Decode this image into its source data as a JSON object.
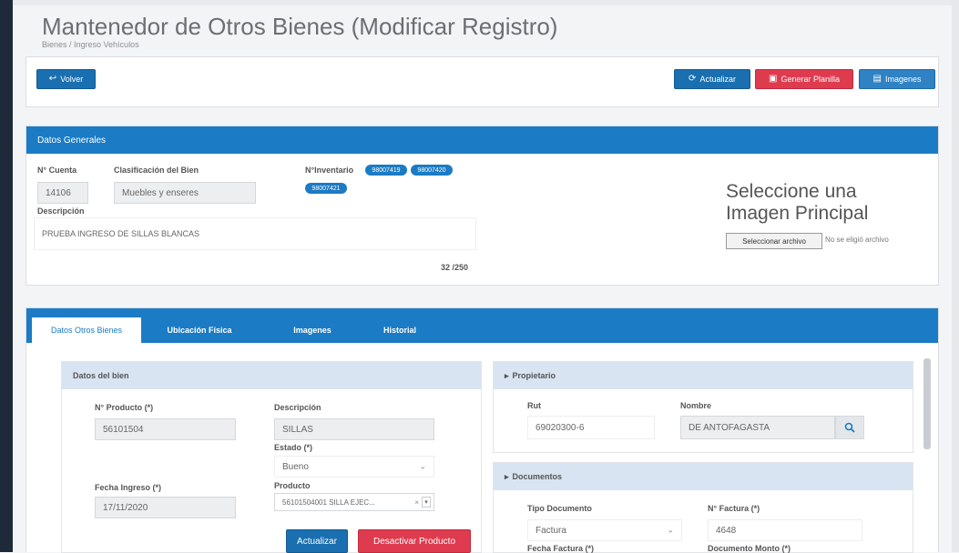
{
  "page": {
    "title": "Mantenedor de Otros Bienes (Modificar Registro)",
    "breadcrumb": "Bienes / Ingreso Vehículos"
  },
  "toolbar": {
    "back_label": "Volver",
    "update_label": "Actualizar",
    "generate_label": "Generar Planilla",
    "images_label": "Imagenes"
  },
  "general": {
    "header": "Datos Generales",
    "account_label": "N° Cuenta",
    "account_value": "14106",
    "classification_label": "Clasificación del Bien",
    "classification_value": "Muebles y enseres",
    "inventory_label": "N°Inventario",
    "inventory_pills": [
      "98007419",
      "98007420",
      "98007421"
    ],
    "description_label": "Descripción",
    "description_value": "PRUEBA INGRESO DE SILLAS BLANCAS",
    "char_count": "32 /250",
    "image_prompt_line1": "Seleccione una",
    "image_prompt_line2": "Imagen Principal",
    "file_button": "Seleccionar archivo",
    "file_status": "No se eligió archivo"
  },
  "tabs": [
    {
      "label": "Datos Otros Bienes"
    },
    {
      "label": "Ubicación Física"
    },
    {
      "label": "Imagenes"
    },
    {
      "label": "Historial"
    }
  ],
  "bien": {
    "header": "Datos del bien",
    "product_no_label": "N° Producto (*)",
    "product_no_value": "56101504",
    "description_label": "Descripción",
    "description_value": "SILLAS",
    "state_label": "Estado (*)",
    "state_value": "Bueno",
    "entry_date_label": "Fecha Ingreso (*)",
    "entry_date_value": "17/11/2020",
    "product_label": "Producto",
    "product_value": "56101504001 SILLA EJEC...",
    "update_button": "Actualizar",
    "deactivate_button": "Desactivar Producto"
  },
  "owner": {
    "header": "Propietario",
    "rut_label": "Rut",
    "rut_value": "69020300-6",
    "name_label": "Nombre",
    "name_value": "DE ANTOFAGASTA"
  },
  "documents": {
    "header": "Documentos",
    "doc_type_label": "Tipo Documento",
    "doc_type_value": "Factura",
    "invoice_no_label": "N° Factura (*)",
    "invoice_no_value": "4648",
    "invoice_date_label": "Fecha Factura (*)",
    "amount_label": "Documento Monto (*)"
  },
  "icons": {
    "back": "arrow-left-icon",
    "update": "refresh-icon",
    "pdf": "pdf-icon",
    "images": "images-icon",
    "search": "search-icon"
  },
  "colors": {
    "primary": "#1b7bc4",
    "danger": "#de3b4f",
    "subheader": "#d8e4f1"
  }
}
